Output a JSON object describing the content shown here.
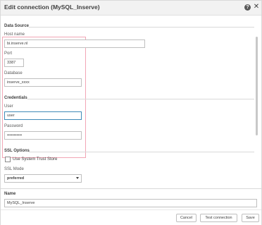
{
  "dialog": {
    "title": "Edit connection (MySQL_Inserve)",
    "help_icon": "?",
    "close_icon": "✕"
  },
  "data_source": {
    "section_title": "Data Source",
    "host": {
      "label": "Host name",
      "value": "bi.inserve.nl"
    },
    "port": {
      "label": "Port",
      "value": "3387"
    },
    "database": {
      "label": "Database",
      "value": "inserve_xxxx"
    }
  },
  "credentials": {
    "section_title": "Credentials",
    "user": {
      "label": "User",
      "value": "user"
    },
    "password": {
      "label": "Password",
      "value": "•••••••••••"
    }
  },
  "ssl": {
    "section_title": "SSL Options",
    "trust_store_label": "Use System Trust Store",
    "trust_store_checked": false,
    "mode_label": "SSL Mode",
    "mode_value": "preferred"
  },
  "name": {
    "label": "Name",
    "value": "MySQL_Inserve"
  },
  "footer": {
    "cancel_label": "Cancel",
    "test_label": "Test connection",
    "save_label": "Save"
  },
  "colors": {
    "highlight_border": "#f2a6b5",
    "focus_border": "#3f8ab7"
  }
}
